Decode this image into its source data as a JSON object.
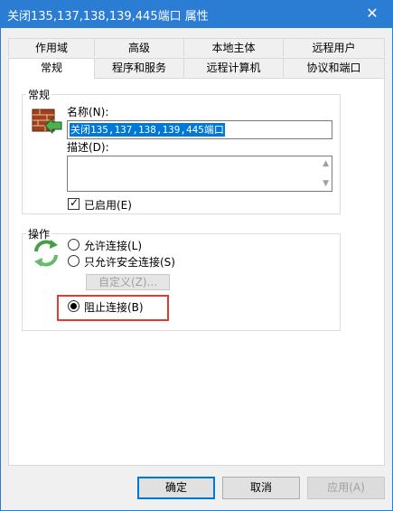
{
  "window": {
    "title": "关闭135,137,138,139,445端口 属性",
    "close_glyph": "✕"
  },
  "tabs_row1": [
    {
      "label": "作用域"
    },
    {
      "label": "高级"
    },
    {
      "label": "本地主体"
    },
    {
      "label": "远程用户"
    }
  ],
  "tabs_row2": [
    {
      "label": "常规",
      "active": true
    },
    {
      "label": "程序和服务"
    },
    {
      "label": "远程计算机"
    },
    {
      "label": "协议和端口"
    }
  ],
  "general": {
    "group_title": "常规",
    "name_label": "名称(N):",
    "name_value": "关闭135,137,138,139,445端口",
    "desc_label": "描述(D):",
    "desc_value": "",
    "enabled_label": "已启用(E)",
    "enabled_checked": true
  },
  "action": {
    "group_title": "操作",
    "allow_label": "允许连接(L)",
    "allow_secure_label": "只允许安全连接(S)",
    "custom_button": "自定义(Z)...",
    "block_label": "阻止连接(B)",
    "selected": "block"
  },
  "buttons": {
    "ok": "确定",
    "cancel": "取消",
    "apply": "应用(A)"
  }
}
